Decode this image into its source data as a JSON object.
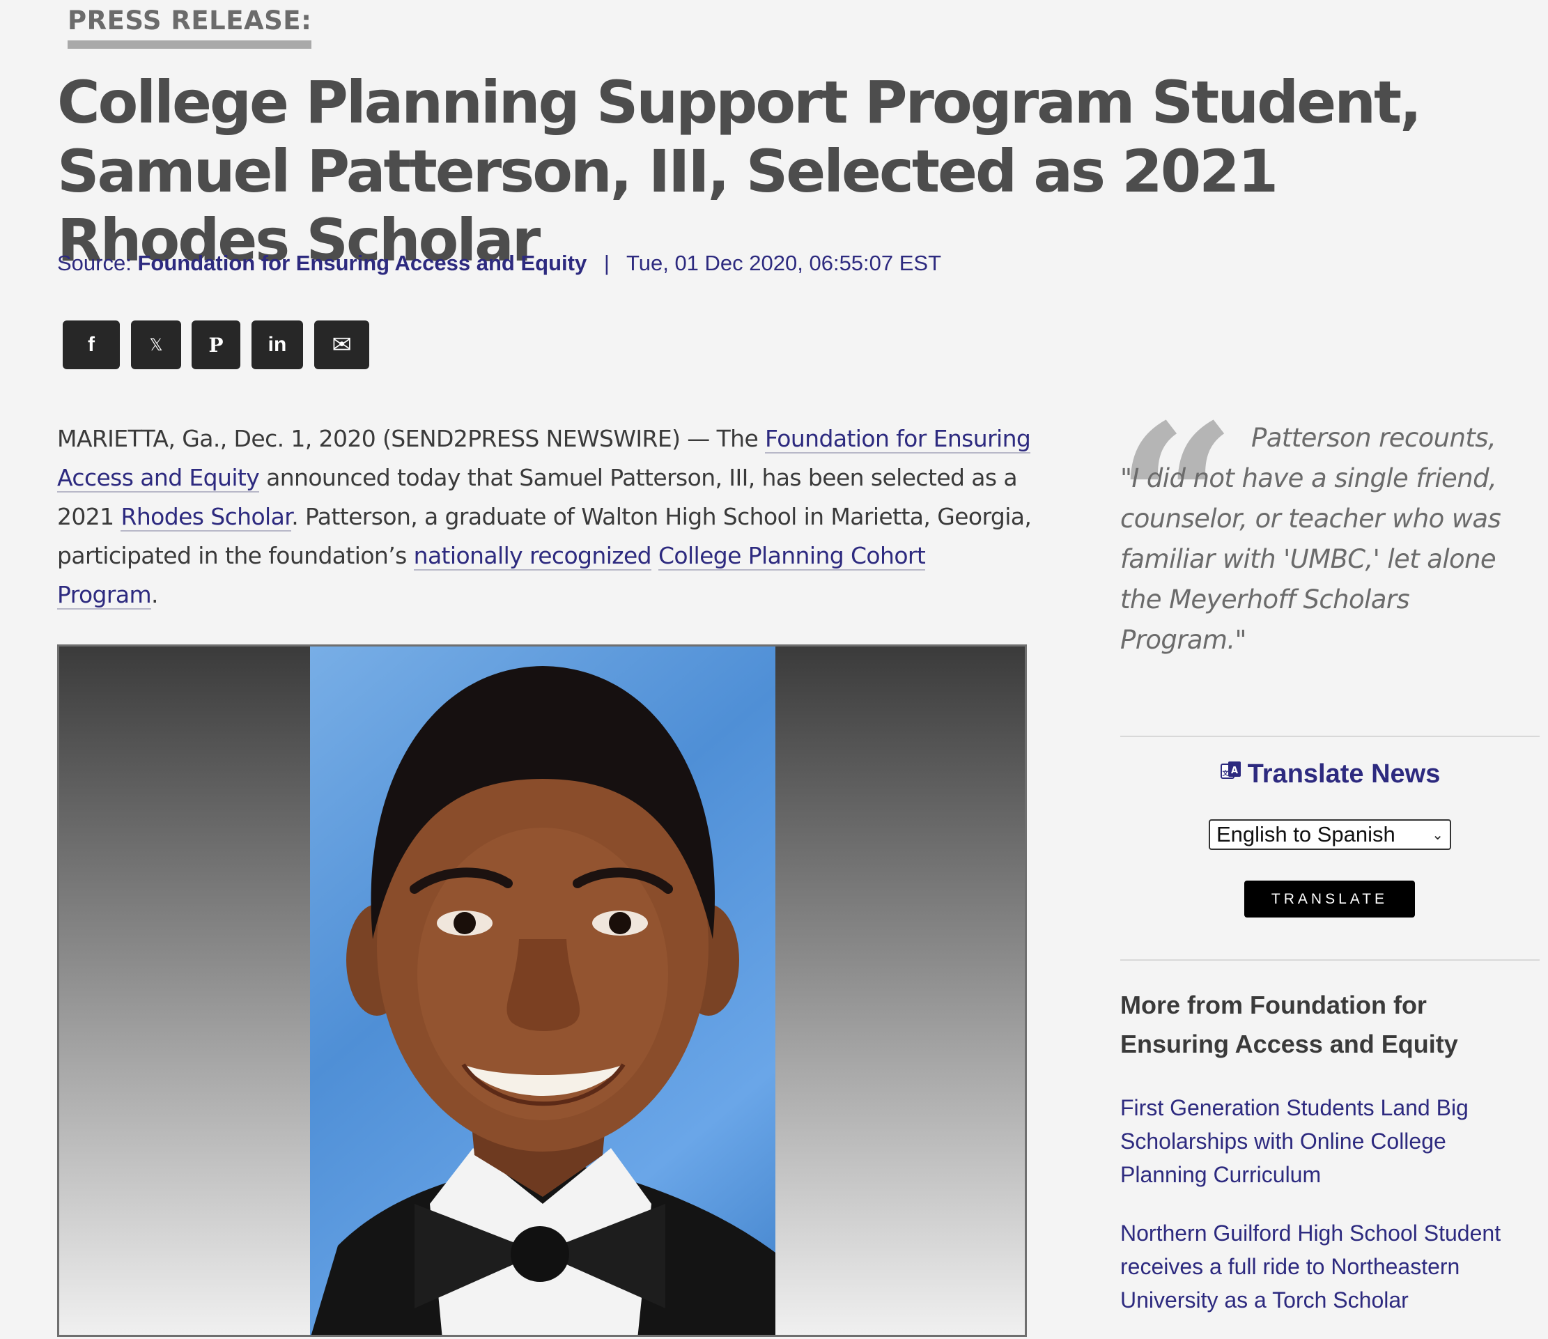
{
  "kicker": "PRESS RELEASE:",
  "headline": "College Planning Support Program Student, Samuel Patterson, III, Selected as 2021 Rhodes Scholar",
  "meta": {
    "source_label": "Source:",
    "source_name": "Foundation for Ensuring Access and Equity",
    "separator": "|",
    "datetime": "Tue, 01 Dec 2020, 06:55:07 EST"
  },
  "share": [
    {
      "name": "facebook",
      "glyph": "f"
    },
    {
      "name": "x",
      "glyph": "𝕏"
    },
    {
      "name": "pinterest",
      "glyph": "P"
    },
    {
      "name": "linkedin",
      "glyph": "in"
    },
    {
      "name": "email",
      "glyph": "✉"
    }
  ],
  "lede": {
    "t1": "MARIETTA, Ga., Dec. 1, 2020 (SEND2PRESS NEWSWIRE) — The ",
    "link1": "Foundation for Ensuring Access and Equity",
    "t2": " announced today that Samuel Patterson, III, has been selected as a 2021 ",
    "link2": "Rhodes Scholar",
    "t3": ". Patterson, a graduate of Walton High School in Marietta, Georgia, participated in the foundation’s ",
    "link3": "nationally recognized",
    "t4": " ",
    "link4": "College Planning Cohort Program",
    "t5": "."
  },
  "pullquote": {
    "mark": "“",
    "text": "Patterson recounts, \"I did not have a single friend, counselor, or teacher who was familiar with 'UMBC,' let alone the Meyerhoff Scholars Program.\""
  },
  "translate": {
    "title": "Translate News",
    "select_value": "English to Spanish",
    "button": "TRANSLATE"
  },
  "more": {
    "title": "More from Foundation for Ensuring Access and Equity",
    "links": [
      "First Generation Students Land Big Scholarships with Online College Planning Curriculum",
      "Northern Guilford High School Student receives a full ride to Northeastern University as a Torch Scholar"
    ]
  },
  "colors": {
    "link": "#2d2a7f",
    "background": "#f4f4f4",
    "share_button": "#272727"
  }
}
